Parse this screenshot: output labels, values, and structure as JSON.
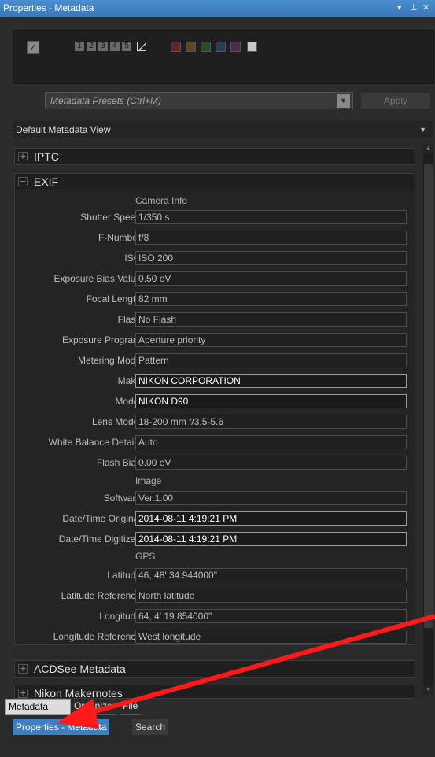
{
  "window": {
    "title": "Properties - Metadata",
    "controls": [
      "▾",
      "⊥",
      "✕"
    ]
  },
  "ratings": [
    "1",
    "2",
    "3",
    "4",
    "5"
  ],
  "color_labels": [
    "#5c2a2a",
    "#5a4a26",
    "#2c4a2c",
    "#26405a",
    "#4a2c52",
    "#c8c8c8"
  ],
  "presets": {
    "placeholder": "Metadata Presets (Ctrl+M)",
    "apply": "Apply"
  },
  "view": {
    "selected": "Default Metadata View"
  },
  "sections": {
    "iptc": "IPTC",
    "exif": "EXIF",
    "acdsee": "ACDSee Metadata",
    "nikon": "Nikon Makernotes"
  },
  "groups": {
    "camera": "Camera Info",
    "image": "Image",
    "gps": "GPS"
  },
  "fields": {
    "shutter": {
      "label": "Shutter Speed",
      "value": "1/350 s"
    },
    "fnumber": {
      "label": "F-Number",
      "value": "f/8"
    },
    "iso": {
      "label": "ISO",
      "value": "ISO 200"
    },
    "expbias": {
      "label": "Exposure Bias Value",
      "value": "0.50 eV"
    },
    "focal": {
      "label": "Focal Length",
      "value": "82 mm"
    },
    "flash": {
      "label": "Flash",
      "value": "No Flash"
    },
    "expprog": {
      "label": "Exposure Program",
      "value": "Aperture priority"
    },
    "meter": {
      "label": "Metering Mode",
      "value": "Pattern"
    },
    "make": {
      "label": "Make",
      "value": "NIKON CORPORATION"
    },
    "model": {
      "label": "Model",
      "value": "NIKON D90"
    },
    "lens": {
      "label": "Lens Model",
      "value": "18-200 mm f/3.5-5.6"
    },
    "wb": {
      "label": "White Balance Details",
      "value": "Auto"
    },
    "flashbias": {
      "label": "Flash Bias",
      "value": "0.00 eV"
    },
    "software": {
      "label": "Software",
      "value": "Ver.1.00"
    },
    "dto": {
      "label": "Date/Time Original",
      "value": "2014-08-11 4:19:21 PM"
    },
    "dtd": {
      "label": "Date/Time Digitized",
      "value": "2014-08-11 4:19:21 PM"
    },
    "lat": {
      "label": "Latitude",
      "value": "46, 48' 34.944000\""
    },
    "latref": {
      "label": "Latitude Reference",
      "value": "North latitude"
    },
    "lon": {
      "label": "Longitude",
      "value": "64, 4' 19.854000\""
    },
    "lonref": {
      "label": "Longitude Reference",
      "value": "West longitude"
    }
  },
  "tabs": {
    "metadata": "Metadata",
    "organize": "Organize",
    "file": "File"
  },
  "bottom_tabs": {
    "props": "Properties - Metadata",
    "search": "Search"
  },
  "annotation": {
    "arrow_color": "#ff1a1a"
  }
}
